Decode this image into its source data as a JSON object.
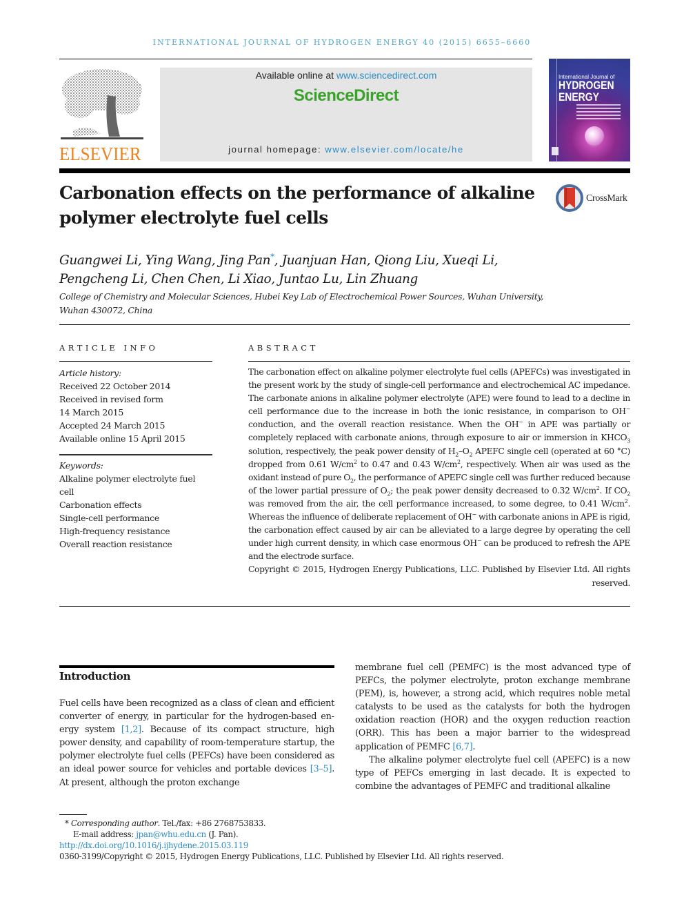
{
  "running_head": "INTERNATIONAL JOURNAL OF HYDROGEN ENERGY 40 (2015) 6655–6660",
  "masthead": {
    "publisher_logo_text": "ELSEVIER",
    "available_online_prefix": "Available online at ",
    "available_online_link": "www.sciencedirect.com",
    "platform_logo_text": "ScienceDirect",
    "homepage_prefix": "journal homepage: ",
    "homepage_link": "www.elsevier.com/locate/he",
    "cover": {
      "line1": "International Journal of",
      "line2": "HYDROGEN",
      "line3": "ENERGY"
    },
    "colors": {
      "elsevier_orange": "#f0821e",
      "sciencedirect_green": "#3aa12b",
      "link_blue": "#2b8cc4",
      "panel_gray": "#e5e5e5"
    }
  },
  "article": {
    "title_line1": "Carbonation effects on the performance of alkaline",
    "title_line2": "polymer electrolyte fuel cells",
    "crossmark_label": "CrossMark",
    "authors_part1": "Guangwei Li, Ying Wang, Jing Pan",
    "corresponding_marker": "*",
    "authors_part2": ", Juanjuan Han, Qiong Liu, Xueqi Li,",
    "authors_line2": "Pengcheng Li, Chen Chen, Li Xiao, Juntao Lu, Lin Zhuang",
    "affiliation_line1": "College of Chemistry and Molecular Sciences, Hubei Key Lab of Electrochemical Power Sources, Wuhan University,",
    "affiliation_line2": "Wuhan 430072, China"
  },
  "article_info": {
    "label": "ARTICLE INFO",
    "history_heading": "Article history:",
    "history": [
      "Received 22 October 2014",
      "Received in revised form",
      "14 March 2015",
      "Accepted 24 March 2015",
      "Available online 15 April 2015"
    ],
    "keywords_heading": "Keywords:",
    "keywords": [
      "Alkaline polymer electrolyte fuel",
      "cell",
      "Carbonation effects",
      "Single-cell performance",
      "High-frequency resistance",
      "Overall reaction resistance"
    ]
  },
  "abstract": {
    "label": "ABSTRACT",
    "s1": "The carbonation effect on alkaline polymer electrolyte fuel cells (APEFCs) was investigated in the present work by the study of single-cell performance and electrochemical AC impedance. The carbonate anions in alkaline polymer electrolyte (APE) were found to lead to a decline in cell performance due to the increase in both the ionic resistance, in com­parison to OH",
    "s2": " conduction, and the overall reaction resistance. When the OH",
    "s3": " in APE was partially or completely replaced with carbonate anions, through exposure to air or im­mersion in KHCO",
    "s4": " solution, respectively, the peak power density of H",
    "s5": "–O",
    "s6": " APEFC single cell (operated at 60 °C) dropped from 0.61 W/cm",
    "s7": " to 0.47 and 0.43 W/cm",
    "s8": ", respectively. When air was used as the oxidant instead of pure O",
    "s9": ", the performance of APEFC single cell was further reduced because of the lower partial pressure of O",
    "s10": "; the peak power density decreased to 0.32 W/cm",
    "s11": ". If CO",
    "s12": " was removed from the air, the cell performance increased, to some degree, to 0.41 W/cm",
    "s13": ". Whereas the influence of deliberate replacement of OH",
    "s14": " with carbonate anions in APE is rigid, the carbonation effect caused by air can be alleviated to a large degree by operating the cell under high current density, in which case enormous OH",
    "s15": " can be produced to refresh the APE and the electrode surface.",
    "minus": "−",
    "sub3": "3",
    "sub2": "2",
    "sup2": "2",
    "copyright": "Copyright © 2015, Hydrogen Energy Publications, LLC. Published by Elsevier Ltd. All rights reserved."
  },
  "introduction": {
    "heading": "Introduction",
    "left_p1_a": "Fuel cells have been recognized as a class of clean and efficient converter of energy, in particular for the hydrogen-based en­ergy system ",
    "ref1": "[1,2]",
    "left_p1_b": ". Because of its compact structure, high power density, and capability of room-temperature startup, the polymer electrolyte fuel cells (PEFCs) have been consid­ered as an ideal power source for vehicles and portable de­vices ",
    "ref2": "[3–5]",
    "left_p1_c": ". At present, although the proton exchange",
    "right_p1_a": "membrane fuel cell (PEMFC) is the most advanced type of PEFCs, the polymer electrolyte, proton exchange membrane (PEM), is, however, a strong acid, which requires noble metal catalysts to be used as the catalysts for both the hydrogen oxidation reaction (HOR) and the oxygen reduction reaction (ORR). This has been a major barrier to the widespread application of PEMFC ",
    "ref3": "[6,7]",
    "right_p1_b": ".",
    "right_p2": "The alkaline polymer electrolyte fuel cell (APEFC) is a new type of PEFCs emerging in last decade. It is expected to combine the advantages of PEMFC and traditional alkaline"
  },
  "footnotes": {
    "marker": "*",
    "corresponding_label": "Corresponding author",
    "tel": ". Tel./fax: +86 2768753833.",
    "email_prefix": "E-mail address: ",
    "email": "jpan@whu.edu.cn",
    "email_suffix": " (J. Pan).",
    "doi": "http://dx.doi.org/10.1016/j.ijhydene.2015.03.119",
    "issn_copyright": "0360-3199/Copyright © 2015, Hydrogen Energy Publications, LLC. Published by Elsevier Ltd. All rights reserved."
  }
}
